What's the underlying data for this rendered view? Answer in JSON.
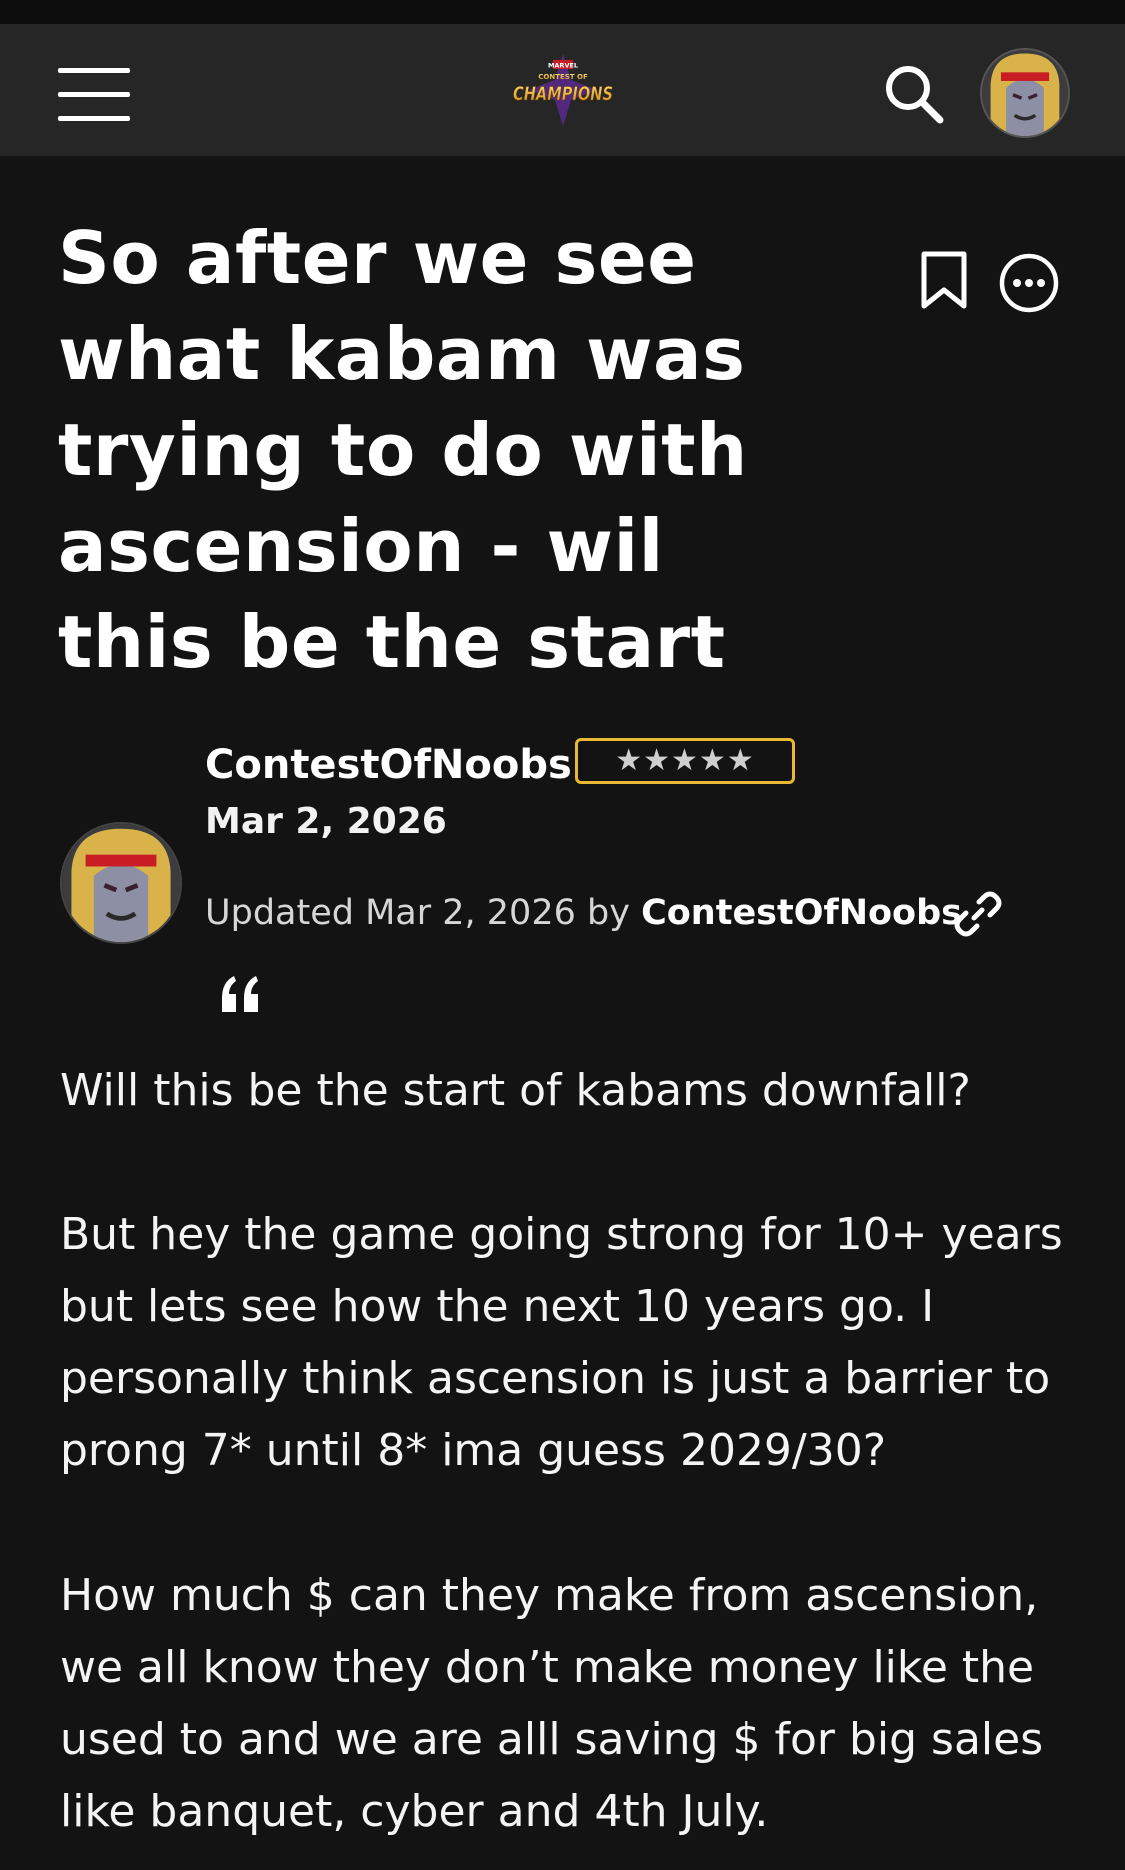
{
  "nav": {
    "menu_icon": "hamburger-menu-icon",
    "logo_text_top": "MARVEL",
    "logo_text_mid": "CONTEST OF",
    "logo_text_main": "CHAMPIONS",
    "search_icon": "search-icon",
    "avatar_icon": "user-avatar"
  },
  "post": {
    "title": "So after we see what kabam was trying to do with ascension - wil this be the start",
    "author": "ContestOfNoobs",
    "rank": "★★★★★",
    "date": "Mar 2, 2026",
    "updated_prefix": "Updated ",
    "updated_date": "Mar 2, 2026",
    "updated_by": " by ",
    "updated_author": "ContestOfNoobs",
    "paragraphs": [
      "Will this be the start of kabams downfall?",
      "But hey the game going strong for 10+ years but lets see how the next 10 years go. I personally think ascension is just a barrier to prong 7* until 8* ima guess 2029/30?",
      "How much $ can they make from ascension, we all know they don’t make money like the used to and we are alll saving $ for big sales like banquet, cyber and 4th July."
    ]
  },
  "colors": {
    "background": "#131314",
    "nav_background": "#262627",
    "badge_border": "#e9b832"
  }
}
